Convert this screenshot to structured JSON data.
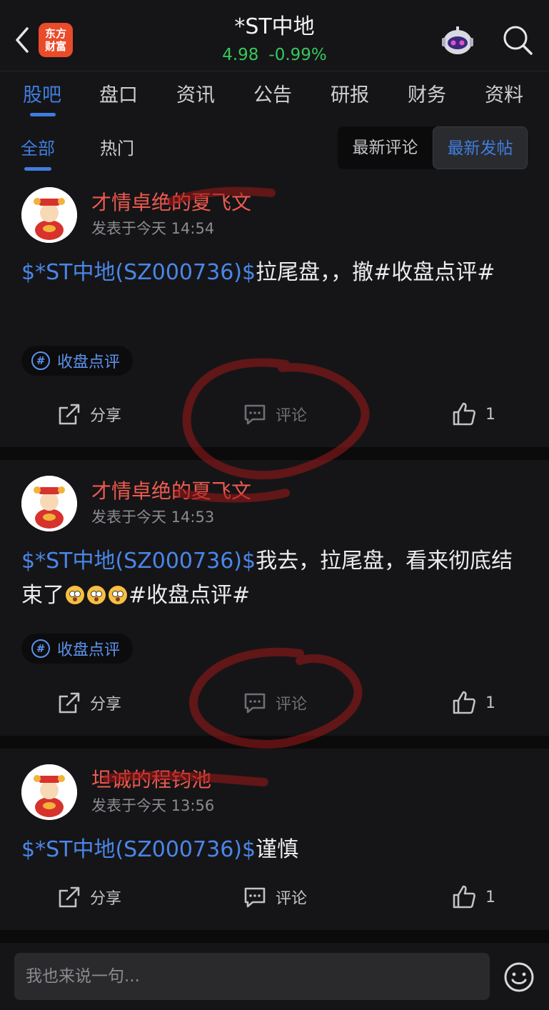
{
  "header": {
    "logo_line1": "东方",
    "logo_line2": "财富",
    "title": "*ST中地",
    "price": "4.98",
    "change": "-0.99%"
  },
  "tabs": [
    "股吧",
    "盘口",
    "资讯",
    "公告",
    "研报",
    "财务",
    "资料"
  ],
  "subtabs": [
    "全部",
    "热门"
  ],
  "sort": [
    "最新评论",
    "最新发帖"
  ],
  "posts": [
    {
      "author": "才情卓绝的夏飞文",
      "time": "发表于今天 14:54",
      "stock": "$*ST中地(SZ000736)$",
      "text": "拉尾盘，，撤#收盘点评#",
      "tag": "收盘点评",
      "share": "分享",
      "comment": "评论",
      "likes": "1"
    },
    {
      "author": "才情卓绝的夏飞文",
      "time": "发表于今天 14:53",
      "stock": "$*ST中地(SZ000736)$",
      "text_before": "我去，拉尾盘，看来彻底结束了",
      "text_after": "#收盘点评#",
      "tag": "收盘点评",
      "share": "分享",
      "comment": "评论",
      "likes": "1"
    },
    {
      "author": "坦诚的程钧池",
      "time": "发表于今天 13:56",
      "stock": "$*ST中地(SZ000736)$",
      "text": "谨慎",
      "share": "分享",
      "comment": "评论",
      "likes": "1"
    }
  ],
  "input": {
    "placeholder": "我也来说一句..."
  },
  "colors": {
    "accent": "#3f7de0",
    "up_green": "#35c85c",
    "author_red": "#ee5a4f",
    "logo": "#ea4b2a"
  }
}
